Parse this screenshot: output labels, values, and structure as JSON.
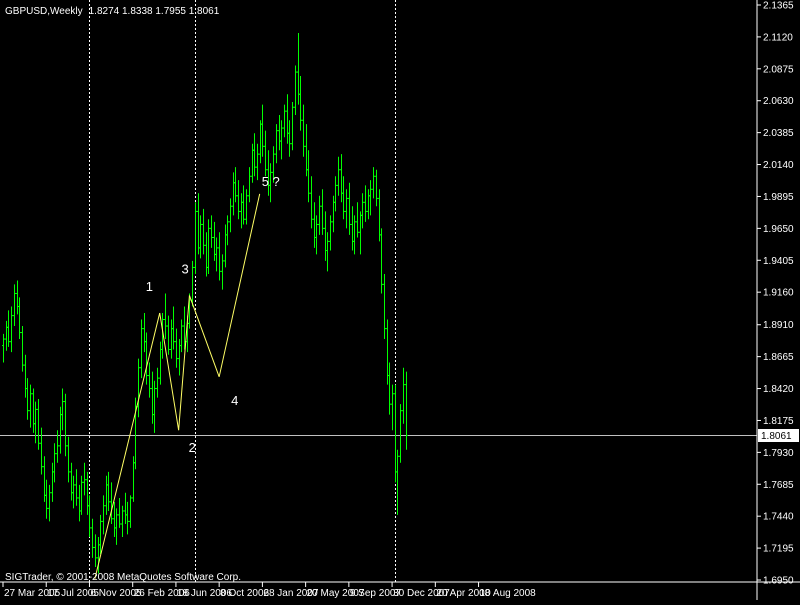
{
  "header": {
    "symbol": "GBPUSD,Weekly",
    "ohlc": "1.8274 1.8338 1.7955 1.8061"
  },
  "footer": {
    "copyright": "SIGTrader, © 2001-2008 MetaQuotes Software Corp."
  },
  "colors": {
    "background": "#000000",
    "candle": "#00ff00",
    "axis": "#ffffff",
    "grid": "#ffffff",
    "wave_line": "#ffff66",
    "price_line": "#c0c0c0"
  },
  "chart_data": {
    "type": "bar",
    "title": "GBPUSD,Weekly",
    "xlabel": "",
    "ylabel": "",
    "ylim": [
      1.695,
      2.1365
    ],
    "grid": false,
    "x_ticks": [
      "27 Mar 2005",
      "17 Jul 2005",
      "6 Nov 2005",
      "26 Feb 2006",
      "18 Jun 2006",
      "8 Oct 2006",
      "28 Jan 2007",
      "20 May 2007",
      "9 Sep 2007",
      "30 Dec 2007",
      "20 Apr 2008",
      "10 Aug 2008"
    ],
    "y_ticks": [
      "2.1365",
      "2.1120",
      "2.0875",
      "2.0630",
      "2.0385",
      "2.0140",
      "1.9895",
      "1.9650",
      "1.9405",
      "1.9160",
      "1.8910",
      "1.8665",
      "1.8420",
      "1.8175",
      "1.7930",
      "1.7685",
      "1.7440",
      "1.7195",
      "1.6950"
    ],
    "current_price": "1.8061",
    "period_separators": [
      "6 Nov 2005",
      "6 Aug 2006",
      "6 Jan 2008"
    ],
    "series": [
      {
        "type": "ohlc",
        "start_date": "2005-03-27",
        "interval": "weekly",
        "values": [
          [
            1.875,
            1.884,
            1.862,
            1.88
          ],
          [
            1.88,
            1.894,
            1.871,
            1.889
          ],
          [
            1.889,
            1.902,
            1.874,
            1.878
          ],
          [
            1.878,
            1.905,
            1.87,
            1.898
          ],
          [
            1.898,
            1.922,
            1.89,
            1.915
          ],
          [
            1.915,
            1.925,
            1.899,
            1.905
          ],
          [
            1.905,
            1.912,
            1.88,
            1.885
          ],
          [
            1.885,
            1.89,
            1.855,
            1.86
          ],
          [
            1.86,
            1.868,
            1.835,
            1.842
          ],
          [
            1.842,
            1.85,
            1.818,
            1.825
          ],
          [
            1.825,
            1.845,
            1.812,
            1.838
          ],
          [
            1.838,
            1.842,
            1.808,
            1.815
          ],
          [
            1.815,
            1.832,
            1.8,
            1.826
          ],
          [
            1.826,
            1.834,
            1.795,
            1.8
          ],
          [
            1.8,
            1.812,
            1.776,
            1.782
          ],
          [
            1.782,
            1.79,
            1.755,
            1.76
          ],
          [
            1.76,
            1.772,
            1.742,
            1.75
          ],
          [
            1.75,
            1.768,
            1.74,
            1.762
          ],
          [
            1.762,
            1.785,
            1.755,
            1.778
          ],
          [
            1.778,
            1.8,
            1.77,
            1.792
          ],
          [
            1.792,
            1.81,
            1.785,
            1.798
          ],
          [
            1.798,
            1.828,
            1.792,
            1.822
          ],
          [
            1.822,
            1.842,
            1.81,
            1.832
          ],
          [
            1.832,
            1.838,
            1.79,
            1.798
          ],
          [
            1.798,
            1.805,
            1.77,
            1.778
          ],
          [
            1.778,
            1.785,
            1.756,
            1.762
          ],
          [
            1.762,
            1.775,
            1.75,
            1.768
          ],
          [
            1.768,
            1.78,
            1.752,
            1.758
          ],
          [
            1.758,
            1.768,
            1.74,
            1.748
          ],
          [
            1.748,
            1.775,
            1.745,
            1.77
          ],
          [
            1.77,
            1.785,
            1.76,
            1.772
          ],
          [
            1.772,
            1.778,
            1.745,
            1.752
          ],
          [
            1.752,
            1.76,
            1.728,
            1.735
          ],
          [
            1.735,
            1.742,
            1.712,
            1.72
          ],
          [
            1.72,
            1.73,
            1.705,
            1.712
          ],
          [
            1.712,
            1.728,
            1.7,
            1.722
          ],
          [
            1.722,
            1.745,
            1.715,
            1.74
          ],
          [
            1.74,
            1.76,
            1.73,
            1.752
          ],
          [
            1.752,
            1.775,
            1.745,
            1.768
          ],
          [
            1.768,
            1.778,
            1.748,
            1.755
          ],
          [
            1.755,
            1.77,
            1.738,
            1.742
          ],
          [
            1.742,
            1.755,
            1.728,
            1.735
          ],
          [
            1.735,
            1.75,
            1.722,
            1.745
          ],
          [
            1.745,
            1.758,
            1.735,
            1.738
          ],
          [
            1.738,
            1.752,
            1.728,
            1.748
          ],
          [
            1.748,
            1.762,
            1.738,
            1.745
          ],
          [
            1.745,
            1.755,
            1.73,
            1.74
          ],
          [
            1.74,
            1.76,
            1.735,
            1.758
          ],
          [
            1.758,
            1.79,
            1.755,
            1.785
          ],
          [
            1.785,
            1.835,
            1.78,
            1.828
          ],
          [
            1.828,
            1.865,
            1.82,
            1.858
          ],
          [
            1.858,
            1.895,
            1.85,
            1.888
          ],
          [
            1.888,
            1.9,
            1.87,
            1.878
          ],
          [
            1.878,
            1.885,
            1.845,
            1.852
          ],
          [
            1.852,
            1.862,
            1.835,
            1.842
          ],
          [
            1.842,
            1.855,
            1.815,
            1.822
          ],
          [
            1.822,
            1.848,
            1.808,
            1.842
          ],
          [
            1.842,
            1.858,
            1.835,
            1.85
          ],
          [
            1.85,
            1.878,
            1.845,
            1.872
          ],
          [
            1.872,
            1.9,
            1.865,
            1.895
          ],
          [
            1.895,
            1.915,
            1.88,
            1.89
          ],
          [
            1.89,
            1.898,
            1.868,
            1.872
          ],
          [
            1.872,
            1.895,
            1.865,
            1.888
          ],
          [
            1.888,
            1.905,
            1.872,
            1.878
          ],
          [
            1.878,
            1.888,
            1.858,
            1.865
          ],
          [
            1.865,
            1.88,
            1.852,
            1.875
          ],
          [
            1.875,
            1.895,
            1.87,
            1.89
          ],
          [
            1.89,
            1.905,
            1.872,
            1.878
          ],
          [
            1.878,
            1.898,
            1.87,
            1.892
          ],
          [
            1.892,
            1.915,
            1.888,
            1.91
          ],
          [
            1.91,
            1.94,
            1.905,
            1.935
          ],
          [
            1.935,
            1.985,
            1.93,
            1.978
          ],
          [
            1.978,
            1.992,
            1.945,
            1.95
          ],
          [
            1.95,
            1.975,
            1.942,
            1.968
          ],
          [
            1.968,
            1.98,
            1.945,
            1.952
          ],
          [
            1.952,
            1.962,
            1.928,
            1.935
          ],
          [
            1.935,
            1.972,
            1.93,
            1.965
          ],
          [
            1.965,
            1.975,
            1.95,
            1.958
          ],
          [
            1.958,
            1.97,
            1.94,
            1.945
          ],
          [
            1.945,
            1.958,
            1.932,
            1.95
          ],
          [
            1.95,
            1.962,
            1.925,
            1.932
          ],
          [
            1.932,
            1.945,
            1.918,
            1.94
          ],
          [
            1.94,
            1.968,
            1.935,
            1.96
          ],
          [
            1.96,
            1.975,
            1.952,
            1.97
          ],
          [
            1.97,
            1.988,
            1.962,
            1.982
          ],
          [
            1.982,
            2.008,
            1.975,
            2.0
          ],
          [
            2.0,
            2.012,
            1.985,
            1.99
          ],
          [
            1.99,
            2.002,
            1.972,
            1.978
          ],
          [
            1.978,
            1.992,
            1.965,
            1.985
          ],
          [
            1.985,
            1.998,
            1.968,
            1.972
          ],
          [
            1.972,
            1.995,
            1.968,
            1.99
          ],
          [
            1.99,
            2.012,
            1.985,
            2.005
          ],
          [
            2.005,
            2.03,
            2.0,
            2.025
          ],
          [
            2.025,
            2.038,
            2.005,
            2.012
          ],
          [
            2.012,
            2.03,
            2.002,
            2.022
          ],
          [
            2.022,
            2.048,
            2.015,
            2.045
          ],
          [
            2.045,
            2.06,
            2.02,
            2.028
          ],
          [
            2.028,
            2.04,
            2.005,
            2.01
          ],
          [
            2.01,
            2.025,
            1.99,
            1.998
          ],
          [
            1.998,
            2.015,
            1.985,
            2.008
          ],
          [
            2.008,
            2.028,
            2.0,
            2.022
          ],
          [
            2.022,
            2.045,
            2.015,
            2.04
          ],
          [
            2.04,
            2.052,
            2.025,
            2.032
          ],
          [
            2.032,
            2.048,
            2.018,
            2.042
          ],
          [
            2.042,
            2.06,
            2.035,
            2.055
          ],
          [
            2.055,
            2.068,
            2.03,
            2.038
          ],
          [
            2.038,
            2.048,
            2.02,
            2.03
          ],
          [
            2.03,
            2.062,
            2.025,
            2.058
          ],
          [
            2.058,
            2.09,
            2.052,
            2.085
          ],
          [
            2.085,
            2.115,
            2.06,
            2.068
          ],
          [
            2.068,
            2.082,
            2.04,
            2.048
          ],
          [
            2.048,
            2.06,
            2.02,
            2.028
          ],
          [
            2.028,
            2.045,
            2.005,
            2.01
          ],
          [
            2.01,
            2.025,
            1.985,
            1.992
          ],
          [
            1.992,
            2.005,
            1.965,
            1.972
          ],
          [
            1.972,
            1.985,
            1.95,
            1.958
          ],
          [
            1.958,
            1.975,
            1.945,
            1.968
          ],
          [
            1.968,
            1.99,
            1.96,
            1.982
          ],
          [
            1.982,
            1.995,
            1.96,
            1.965
          ],
          [
            1.965,
            1.978,
            1.94,
            1.948
          ],
          [
            1.948,
            1.962,
            1.932,
            1.955
          ],
          [
            1.955,
            1.975,
            1.948,
            1.97
          ],
          [
            1.97,
            1.99,
            1.962,
            1.985
          ],
          [
            1.985,
            2.005,
            1.978,
            1.998
          ],
          [
            1.998,
            2.02,
            1.99,
            2.01
          ],
          [
            2.01,
            2.022,
            1.985,
            1.992
          ],
          [
            1.992,
            2.005,
            1.972,
            1.978
          ],
          [
            1.978,
            1.995,
            1.965,
            1.988
          ],
          [
            1.988,
            2.0,
            1.96,
            1.968
          ],
          [
            1.968,
            1.982,
            1.948,
            1.955
          ],
          [
            1.955,
            1.975,
            1.945,
            1.97
          ],
          [
            1.97,
            1.985,
            1.958,
            1.962
          ],
          [
            1.962,
            1.978,
            1.945,
            1.975
          ],
          [
            1.975,
            1.992,
            1.965,
            1.985
          ],
          [
            1.985,
            1.998,
            1.97,
            1.978
          ],
          [
            1.978,
            1.995,
            1.972,
            1.99
          ],
          [
            1.99,
            2.002,
            1.975,
            1.995
          ],
          [
            1.995,
            2.012,
            1.988,
            2.005
          ],
          [
            2.005,
            2.01,
            1.982,
            1.988
          ],
          [
            1.988,
            1.995,
            1.955,
            1.96
          ],
          [
            1.96,
            1.965,
            1.915,
            1.922
          ],
          [
            1.922,
            1.93,
            1.88,
            1.888
          ],
          [
            1.888,
            1.895,
            1.845,
            1.852
          ],
          [
            1.852,
            1.862,
            1.822,
            1.83
          ],
          [
            1.83,
            1.845,
            1.81,
            1.838
          ],
          [
            1.838,
            1.845,
            1.77,
            1.778
          ],
          [
            1.778,
            1.795,
            1.745,
            1.79
          ],
          [
            1.79,
            1.83,
            1.785,
            1.825
          ],
          [
            1.825,
            1.858,
            1.815,
            1.845
          ],
          [
            1.845,
            1.855,
            1.795,
            1.806
          ]
        ]
      }
    ],
    "annotations": [
      {
        "label": "1",
        "x": "2006-05-07",
        "y": 1.9
      },
      {
        "label": "2",
        "x": "2006-06-25",
        "y": 1.81
      },
      {
        "label": "3",
        "x": "2006-07-23",
        "y": 1.9135
      },
      {
        "label": "4",
        "x": "2006-10-08",
        "y": 1.851
      },
      {
        "label": "5 ?",
        "x": "2007-01-21",
        "y": 1.9915
      }
    ],
    "wave_path": [
      {
        "x": "2005-11-20",
        "y": 1.696
      },
      {
        "x": "2006-05-07",
        "y": 1.9
      },
      {
        "x": "2006-06-25",
        "y": 1.81
      },
      {
        "x": "2006-07-23",
        "y": 1.9135
      },
      {
        "x": "2006-10-08",
        "y": 1.851
      },
      {
        "x": "2007-01-21",
        "y": 1.9915
      }
    ]
  }
}
